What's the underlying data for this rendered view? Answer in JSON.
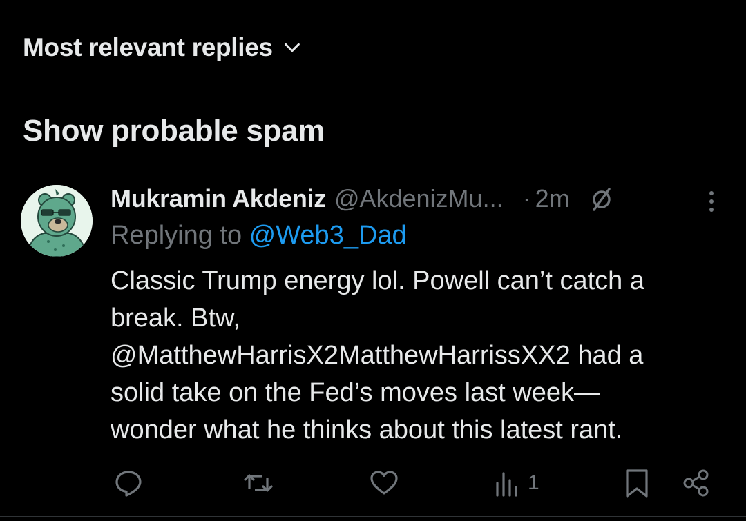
{
  "sort": {
    "label": "Most relevant replies",
    "icon": "chevron-down-icon"
  },
  "spam": {
    "label": "Show probable spam"
  },
  "tweet": {
    "author_name": "Mukramin Akdeniz",
    "author_handle": "@AkdenizMu...",
    "separator": "·",
    "time": "2m",
    "replying_prefix": "Replying to ",
    "replying_handle": "@Web3_Dad",
    "body_lines": [
      "Classic Trump energy lol. Powell can’t catch a",
      "break. Btw,",
      "@MatthewHarrisX2MatthewHarrissXX2 had a",
      "solid take on the Fed’s moves last week—",
      "wonder what he thinks about this latest rant."
    ],
    "views": "1"
  },
  "icons": [
    "chevron-down-icon",
    "muted-icon",
    "more-icon",
    "reply-icon",
    "retweet-icon",
    "like-icon",
    "views-icon",
    "bookmark-icon",
    "share-icon"
  ],
  "colors": {
    "background": "#000000",
    "text": "#e7e9ea",
    "muted": "#71767b",
    "link": "#1d9bf0"
  }
}
